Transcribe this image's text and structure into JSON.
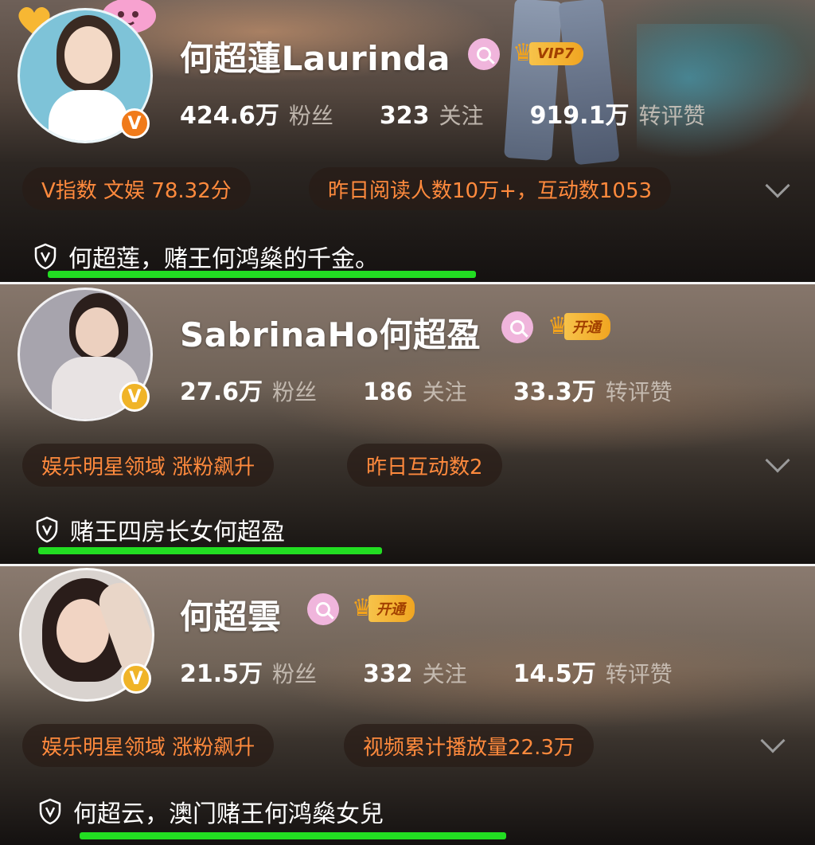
{
  "profiles": [
    {
      "name": "何超蓮Laurinda",
      "membership": "VIP7",
      "followers": "424.6万",
      "followers_label": "粉丝",
      "following": "323",
      "following_label": "关注",
      "interactions": "919.1万",
      "interactions_label": "转评赞",
      "chip1": "V指数 文娱 78.32分",
      "chip2": "昨日阅读人数10万+，互动数1053",
      "bio": "何超莲，赌王何鸿燊的千金。"
    },
    {
      "name": "SabrinaHo何超盈",
      "membership": "开通",
      "followers": "27.6万",
      "followers_label": "粉丝",
      "following": "186",
      "following_label": "关注",
      "interactions": "33.3万",
      "interactions_label": "转评赞",
      "chip1": "娱乐明星领域 涨粉飙升",
      "chip2": "昨日互动数2",
      "bio": "赌王四房长女何超盈"
    },
    {
      "name": "何超雲",
      "membership": "开通",
      "followers": "21.5万",
      "followers_label": "粉丝",
      "following": "332",
      "following_label": "关注",
      "interactions": "14.5万",
      "interactions_label": "转评赞",
      "chip1": "娱乐明星领域 涨粉飙升",
      "chip2": "视频累计播放量22.3万",
      "bio": "何超云，澳门赌王何鸿燊女兒"
    }
  ],
  "verified_badge": "V",
  "colors": {
    "chip_text": "#ff8a3d",
    "highlight_underline": "#22dd22",
    "verified_orange": "#f07a1a",
    "verified_gold": "#f0b428"
  }
}
